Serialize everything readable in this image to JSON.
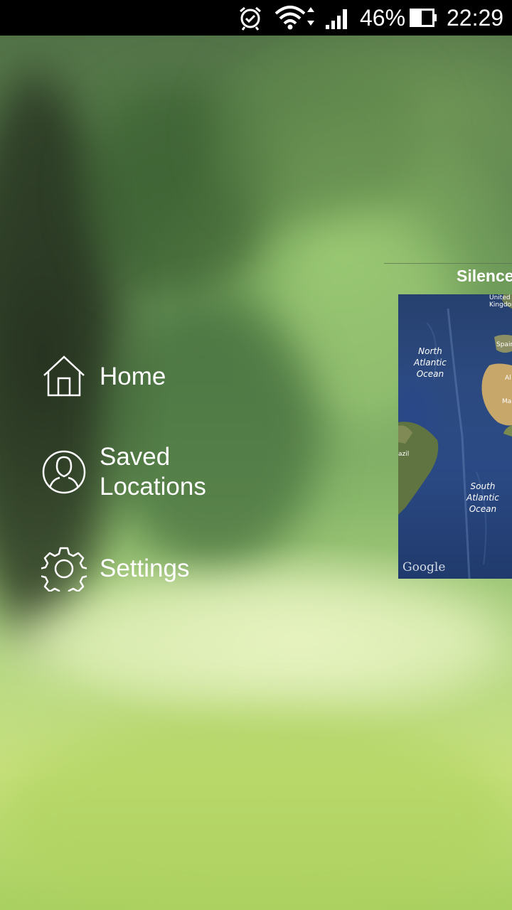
{
  "status_bar": {
    "battery_percent": "46%",
    "time": "22:29",
    "icons": [
      "alarm-icon",
      "wifi-icon",
      "signal-icon",
      "battery-icon"
    ]
  },
  "menu": {
    "items": [
      {
        "label": "Home",
        "icon": "home-icon"
      },
      {
        "label": "Saved Locations",
        "icon": "person-icon"
      },
      {
        "label": "Settings",
        "icon": "gear-icon"
      }
    ]
  },
  "panel": {
    "title": "Silence",
    "map": {
      "labels": {
        "north_atlantic": "North\nAtlantic\nOcean",
        "south_atlantic": "South\nAtlantic\nOcean",
        "united_kingdom": "United\nKingdom",
        "spain": "Spain",
        "algeria": "Al",
        "mali": "Mal",
        "brazil": "azil"
      },
      "attribution": "Google"
    }
  },
  "colors": {
    "status_bar_bg": "#000000",
    "text": "#ffffff",
    "ocean": "#2b4a85"
  }
}
